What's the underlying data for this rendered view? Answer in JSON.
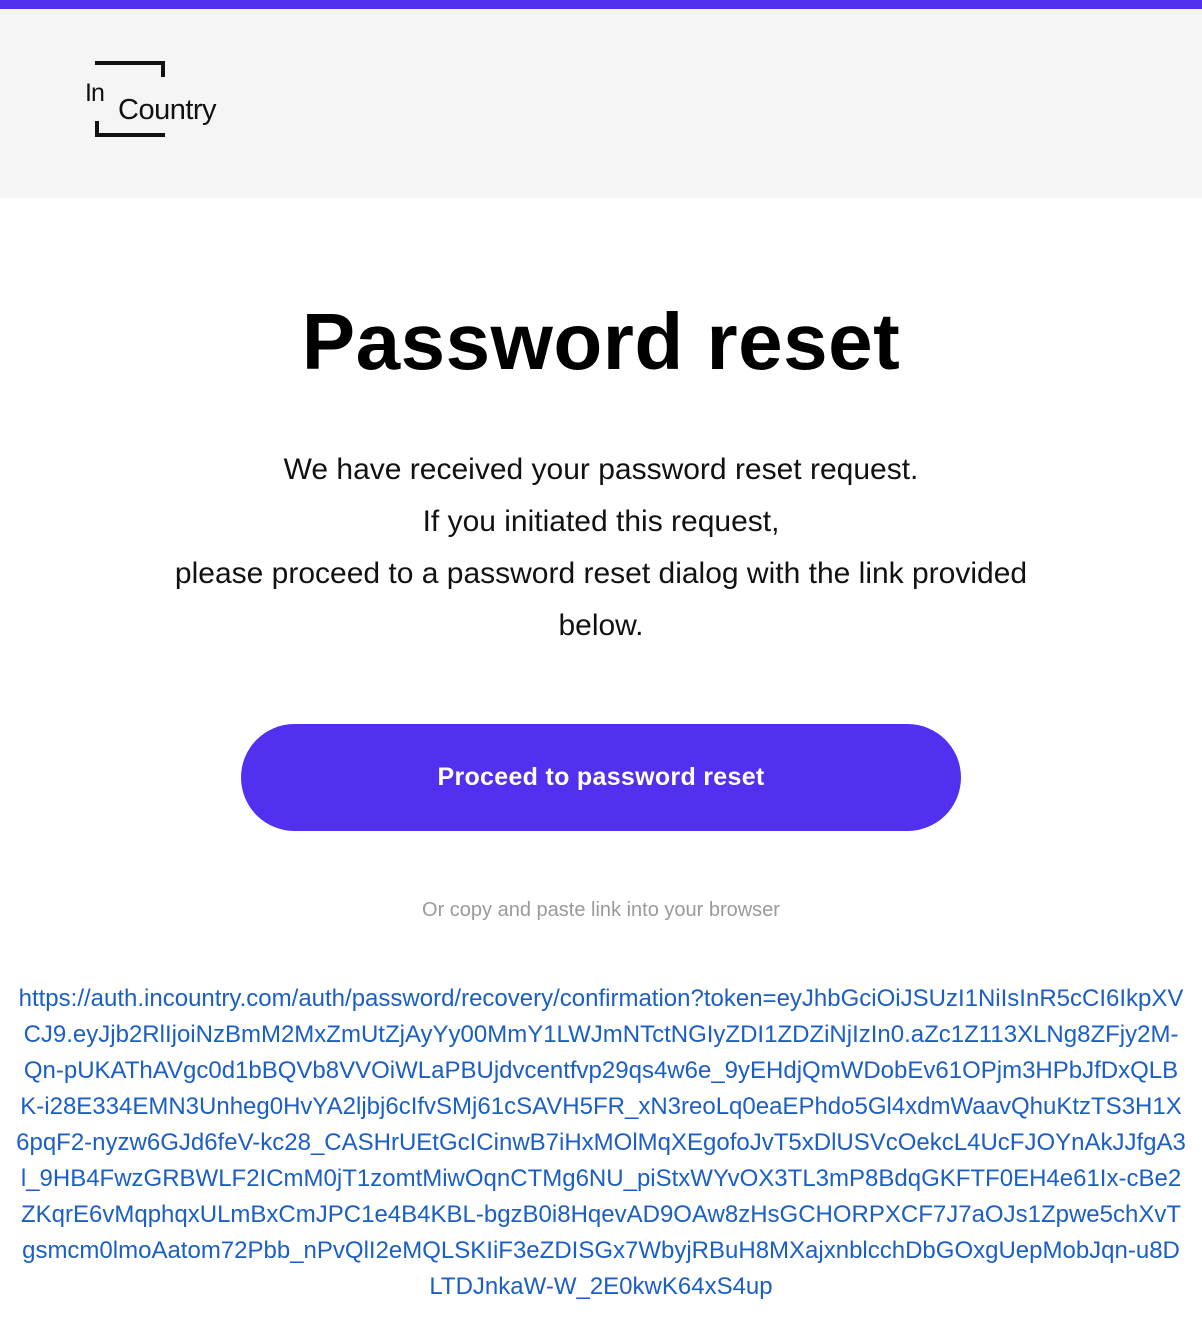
{
  "brand": {
    "logo_small": "In",
    "logo_main": "Country",
    "accent_color": "#5330f0",
    "link_color": "#1b5fc4"
  },
  "email": {
    "title": "Password reset",
    "intro_lines": [
      "We have received your password reset request.",
      "If you initiated this request,",
      "please proceed to a password reset dialog with the link provided below."
    ],
    "cta_label": "Proceed to password reset",
    "copy_hint": "Or copy and paste link into your browser",
    "reset_url": "https://auth.incountry.com/auth/password/recovery/confirmation?token=eyJhbGciOiJSUzI1NiIsInR5cCI6IkpXVCJ9.eyJjb2RlIjoiNzBmM2MxZmUtZjAyYy00MmY1LWJmNTctNGIyZDI1ZDZiNjIzIn0.aZc1Z113XLNg8ZFjy2M-Qn-pUKAThAVgc0d1bBQVb8VVOiWLaPBUjdvcentfvp29qs4w6e_9yEHdjQmWDobEv61OPjm3HPbJfDxQLBK-i28E334EMN3Unheg0HvYA2ljbj6cIfvSMj61cSAVH5FR_xN3reoLq0eaEPhdo5Gl4xdmWaavQhuKtzTS3H1X6pqF2-nyzw6GJd6feV-kc28_CASHrUEtGcICinwB7iHxMOlMqXEgofoJvT5xDlUSVcOekcL4UcFJOYnAkJJfgA3l_9HB4FwzGRBWLF2ICmM0jT1zomtMiwOqnCTMg6NU_piStxWYvOX3TL3mP8BdqGKFTF0EH4e61Ix-cBe2ZKqrE6vMqphqxULmBxCmJPC1e4B4KBL-bgzB0i8HqevAD9OAw8zHsGCHORPXCF7J7aOJs1Zpwe5chXvTgsmcm0lmoAatom72Pbb_nPvQlI2eMQLSKIiF3eZDISGx7WbyjRBuH8MXajxnblcchDbGOxgUepMobJqn-u8DLTDJnkaW-W_2E0kwK64xS4up"
  }
}
